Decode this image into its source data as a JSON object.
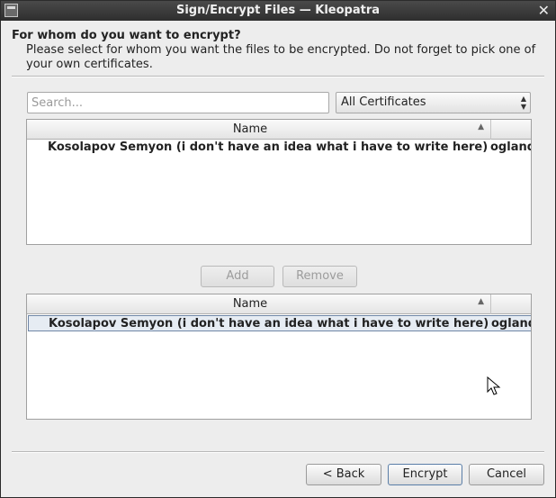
{
  "window": {
    "title": "Sign/Encrypt Files — Kleopatra",
    "close_glyph": "✕"
  },
  "header": {
    "heading": "For whom do you want to encrypt?",
    "description": "Please select for whom you want the files to be encrypted. Do not forget to pick one of your own certificates."
  },
  "search": {
    "placeholder": "Search...",
    "value": ""
  },
  "filter": {
    "selected": "All Certificates",
    "arrows": "▲\n▼"
  },
  "available_table": {
    "column_header": "Name",
    "sort_indicator": "▲",
    "rows": [
      {
        "name": "Kosolapov Semyon (i don't have an idea what i have to write here)",
        "email": "oglandic@gmail.com"
      }
    ]
  },
  "buttons": {
    "add": "Add",
    "remove": "Remove",
    "back": "< Back",
    "encrypt": "Encrypt",
    "cancel": "Cancel"
  },
  "selected_table": {
    "column_header": "Name",
    "sort_indicator": "▲",
    "rows": [
      {
        "name": "Kosolapov Semyon (i don't have an idea what i have to write here)",
        "email": "oglandic@gmail.com",
        "selected": true
      }
    ]
  },
  "scrollbar": {
    "left_arrow": "◀",
    "right_arrow": "▶"
  },
  "colors": {
    "selection_border": "#6f86a6",
    "selection_fill": "#e6ecf3",
    "titlebar": "#2e2e2e"
  }
}
